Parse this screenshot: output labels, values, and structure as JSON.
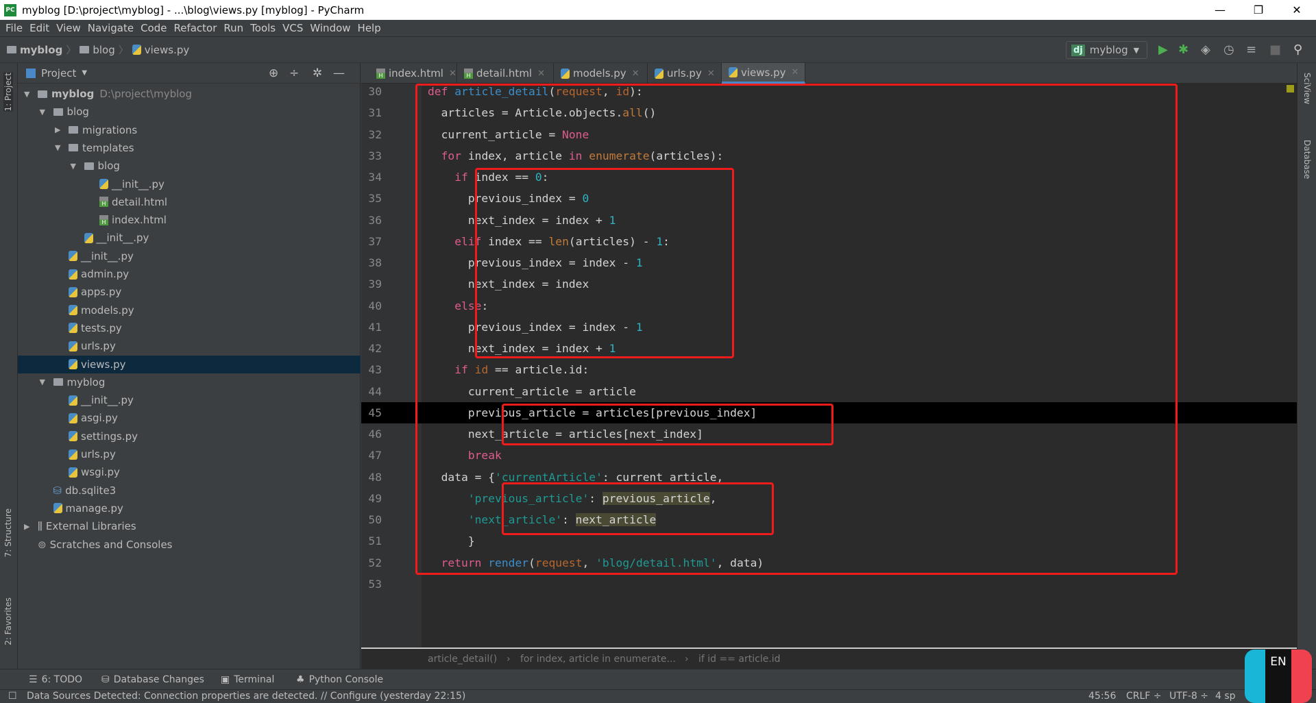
{
  "window": {
    "title": "myblog [D:\\project\\myblog] - ...\\blog\\views.py [myblog] - PyCharm",
    "min": "—",
    "max": "❐",
    "close": "✕"
  },
  "menu": [
    "File",
    "Edit",
    "View",
    "Navigate",
    "Code",
    "Refactor",
    "Run",
    "Tools",
    "VCS",
    "Window",
    "Help"
  ],
  "nav": {
    "crumbs": [
      "myblog",
      "blog",
      "views.py"
    ],
    "run_config": "myblog",
    "dj": "dj"
  },
  "project": {
    "title": "Project",
    "tree": [
      {
        "level": 0,
        "arrow": "open",
        "icon": "folder",
        "label": "myblog",
        "extra": "D:\\project\\myblog",
        "bold": true
      },
      {
        "level": 1,
        "arrow": "open",
        "icon": "folder",
        "label": "blog"
      },
      {
        "level": 2,
        "arrow": "closed",
        "icon": "folder",
        "label": "migrations"
      },
      {
        "level": 2,
        "arrow": "open",
        "icon": "folder",
        "label": "templates"
      },
      {
        "level": 3,
        "arrow": "open",
        "icon": "folder",
        "label": "blog"
      },
      {
        "level": 4,
        "icon": "py",
        "label": "__init__.py"
      },
      {
        "level": 4,
        "icon": "html",
        "label": "detail.html"
      },
      {
        "level": 4,
        "icon": "html",
        "label": "index.html"
      },
      {
        "level": 3,
        "icon": "py",
        "label": "__init__.py"
      },
      {
        "level": 2,
        "icon": "py",
        "label": "__init__.py"
      },
      {
        "level": 2,
        "icon": "py",
        "label": "admin.py"
      },
      {
        "level": 2,
        "icon": "py",
        "label": "apps.py"
      },
      {
        "level": 2,
        "icon": "py",
        "label": "models.py"
      },
      {
        "level": 2,
        "icon": "py",
        "label": "tests.py"
      },
      {
        "level": 2,
        "icon": "py",
        "label": "urls.py"
      },
      {
        "level": 2,
        "icon": "py",
        "label": "views.py",
        "selected": true
      },
      {
        "level": 1,
        "arrow": "open",
        "icon": "folder",
        "label": "myblog"
      },
      {
        "level": 2,
        "icon": "py",
        "label": "__init__.py"
      },
      {
        "level": 2,
        "icon": "py",
        "label": "asgi.py"
      },
      {
        "level": 2,
        "icon": "py",
        "label": "settings.py"
      },
      {
        "level": 2,
        "icon": "py",
        "label": "urls.py"
      },
      {
        "level": 2,
        "icon": "py",
        "label": "wsgi.py"
      },
      {
        "level": 1,
        "icon": "db",
        "label": "db.sqlite3"
      },
      {
        "level": 1,
        "icon": "py",
        "label": "manage.py"
      },
      {
        "level": 0,
        "arrow": "closed",
        "icon": "lib",
        "label": "External Libraries"
      },
      {
        "level": 0,
        "icon": "scratch",
        "label": "Scratches and Consoles"
      }
    ]
  },
  "tabs": [
    {
      "label": "index.html",
      "icon": "html"
    },
    {
      "label": "detail.html",
      "icon": "html"
    },
    {
      "label": "models.py",
      "icon": "py"
    },
    {
      "label": "urls.py",
      "icon": "py"
    },
    {
      "label": "views.py",
      "icon": "py",
      "active": true
    }
  ],
  "editor": {
    "current_line": 45,
    "lines": [
      {
        "n": 30,
        "t": [
          [
            "kw",
            "def"
          ],
          [
            "",
            "  "
          ],
          [
            "fn",
            "article_detail"
          ],
          [
            "",
            "("
          ],
          [
            "pa",
            "request"
          ],
          [
            "",
            ",  "
          ],
          [
            "pa",
            "id"
          ],
          [
            "",
            "):"
          ]
        ]
      },
      {
        "n": 31,
        "t": [
          [
            "",
            "    articles = Article.objects."
          ],
          [
            "bi",
            "all"
          ],
          [
            "",
            "()"
          ]
        ]
      },
      {
        "n": 32,
        "t": [
          [
            "",
            "    current_article = "
          ],
          [
            "kw",
            "None"
          ]
        ]
      },
      {
        "n": 33,
        "t": [
          [
            "",
            "    "
          ],
          [
            "kw",
            "for"
          ],
          [
            "",
            ""
          ],
          [
            "",
            "  index, article "
          ],
          [
            "kw",
            "in"
          ],
          [
            "",
            ""
          ],
          [
            "",
            "  "
          ],
          [
            "bi",
            "enumerate"
          ],
          [
            "",
            "(articles):"
          ]
        ]
      },
      {
        "n": 34,
        "t": [
          [
            "",
            "        "
          ],
          [
            "kw",
            "if"
          ],
          [
            "",
            "  index == "
          ],
          [
            "num",
            "0"
          ],
          [
            "",
            ":"
          ]
        ]
      },
      {
        "n": 35,
        "t": [
          [
            "",
            "            previous_index = "
          ],
          [
            "num",
            "0"
          ]
        ]
      },
      {
        "n": 36,
        "t": [
          [
            "",
            "            next_index = index + "
          ],
          [
            "num",
            "1"
          ]
        ]
      },
      {
        "n": 37,
        "t": [
          [
            "",
            "        "
          ],
          [
            "kw",
            "elif"
          ],
          [
            "",
            "  index == "
          ],
          [
            "bi",
            "len"
          ],
          [
            "",
            "(articles) - "
          ],
          [
            "num",
            "1"
          ],
          [
            "",
            ":"
          ]
        ]
      },
      {
        "n": 38,
        "t": [
          [
            "",
            "            previous_index = index - "
          ],
          [
            "num",
            "1"
          ]
        ]
      },
      {
        "n": 39,
        "t": [
          [
            "",
            "            next_index = index"
          ]
        ]
      },
      {
        "n": 40,
        "t": [
          [
            "",
            "        "
          ],
          [
            "kw",
            "else"
          ],
          [
            "",
            ":"
          ]
        ]
      },
      {
        "n": 41,
        "t": [
          [
            "",
            "            previous_index = index - "
          ],
          [
            "num",
            "1"
          ]
        ]
      },
      {
        "n": 42,
        "t": [
          [
            "",
            "            next_index = index + "
          ],
          [
            "num",
            "1"
          ]
        ]
      },
      {
        "n": 43,
        "t": [
          [
            "",
            "        "
          ],
          [
            "kw",
            "if"
          ],
          [
            "",
            "  "
          ],
          [
            "pa",
            "id"
          ],
          [
            "",
            "  == article.id:"
          ]
        ]
      },
      {
        "n": 44,
        "t": [
          [
            "",
            "            current_article = article"
          ]
        ]
      },
      {
        "n": 45,
        "t": [
          [
            "",
            "            previous_article = articles[previous_index]"
          ]
        ]
      },
      {
        "n": 46,
        "t": [
          [
            "",
            "            next_article = articles[next_index]"
          ]
        ]
      },
      {
        "n": 47,
        "t": [
          [
            "",
            "            "
          ],
          [
            "kw",
            "break"
          ]
        ]
      },
      {
        "n": 48,
        "t": [
          [
            "",
            "    data = {"
          ],
          [
            "str",
            "'currentArticle'"
          ],
          [
            "",
            ": current_article,"
          ]
        ]
      },
      {
        "n": 49,
        "t": [
          [
            "",
            "            "
          ],
          [
            "str",
            "'previous_article'"
          ],
          [
            "",
            ": "
          ],
          [
            "hl",
            "previous_article"
          ],
          [
            "",
            ","
          ]
        ]
      },
      {
        "n": 50,
        "t": [
          [
            "",
            "            "
          ],
          [
            "str",
            "'next_article'"
          ],
          [
            "",
            ": "
          ],
          [
            "hl",
            "next_article"
          ]
        ]
      },
      {
        "n": 51,
        "t": [
          [
            "",
            "            }"
          ]
        ]
      },
      {
        "n": 52,
        "t": [
          [
            "",
            "    "
          ],
          [
            "kw",
            "return"
          ],
          [
            "",
            "  "
          ],
          [
            "fn",
            "render"
          ],
          [
            "",
            "("
          ],
          [
            "pa",
            "request"
          ],
          [
            "",
            ",  "
          ],
          [
            "str",
            "'blog/detail.html'"
          ],
          [
            "",
            ",  data)"
          ]
        ]
      },
      {
        "n": 53,
        "t": []
      }
    ]
  },
  "breadcrumb": [
    "article_detail()",
    "for index, article in enumerate...",
    "if id == article.id"
  ],
  "left_stripe": [
    "1: Project",
    "7: Structure",
    "2: Favorites"
  ],
  "right_stripe": [
    "SciView",
    "Database"
  ],
  "bottom_tools": [
    "6: TODO",
    "Database Changes",
    "Terminal",
    "Python Console"
  ],
  "status": {
    "message": "Data Sources Detected: Connection properties are detected. // Configure (yesterday 22:15)",
    "position": "45:56",
    "line_sep": "CRLF ÷",
    "encoding": "UTF-8 ÷",
    "indent": "4 sp",
    "ime": "EN"
  },
  "colors": {
    "highlight_box": "#f01c1c",
    "keyword": "#df5c8f",
    "function": "#3d8ec9",
    "string": "#1f9a94",
    "number": "#2fb3c4",
    "selection": "#0d293e"
  }
}
